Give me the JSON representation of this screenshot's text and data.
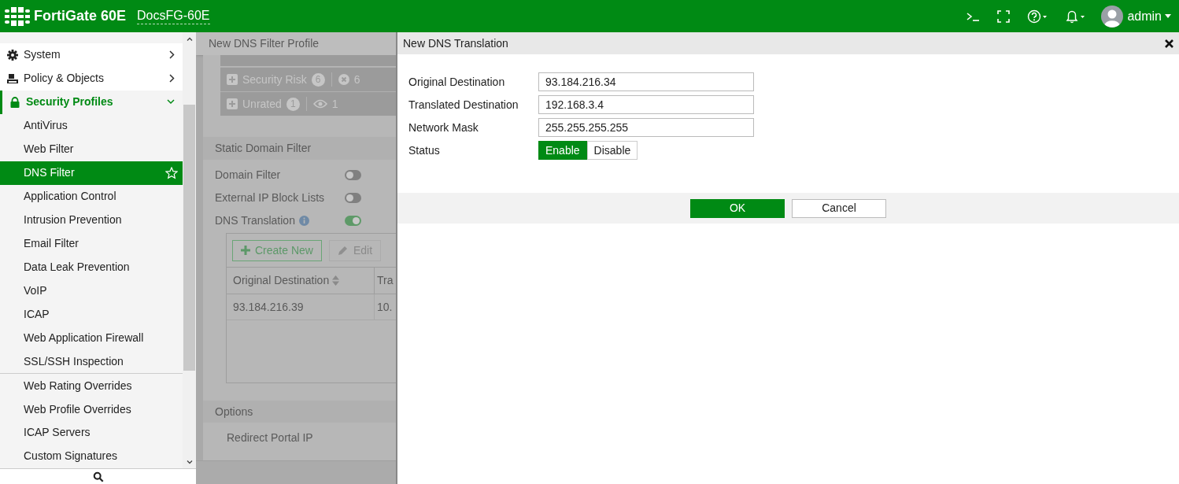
{
  "header": {
    "product": "FortiGate 60E",
    "hostname": "DocsFG-60E",
    "user": "admin"
  },
  "sidebar": {
    "items": [
      {
        "label": "System",
        "expanded": false
      },
      {
        "label": "Policy & Objects",
        "expanded": false
      },
      {
        "label": "Security Profiles",
        "expanded": true,
        "children": [
          {
            "label": "AntiVirus",
            "separator_above": false,
            "selected": false
          },
          {
            "label": "Web Filter",
            "separator_above": false,
            "selected": false
          },
          {
            "label": "DNS Filter",
            "separator_above": false,
            "selected": true
          },
          {
            "label": "Application Control",
            "separator_above": false,
            "selected": false
          },
          {
            "label": "Intrusion Prevention",
            "separator_above": false,
            "selected": false
          },
          {
            "label": "Email Filter",
            "separator_above": false,
            "selected": false
          },
          {
            "label": "Data Leak Prevention",
            "separator_above": false,
            "selected": false
          },
          {
            "label": "VoIP",
            "separator_above": false,
            "selected": false
          },
          {
            "label": "ICAP",
            "separator_above": false,
            "selected": false
          },
          {
            "label": "Web Application Firewall",
            "separator_above": false,
            "selected": false
          },
          {
            "label": "SSL/SSH Inspection",
            "separator_above": false,
            "selected": false
          },
          {
            "label": "Web Rating Overrides",
            "separator_above": true,
            "selected": false
          },
          {
            "label": "Web Profile Overrides",
            "separator_above": false,
            "selected": false
          },
          {
            "label": "ICAP Servers",
            "separator_above": false,
            "selected": false
          },
          {
            "label": "Custom Signatures",
            "separator_above": false,
            "selected": false
          }
        ]
      }
    ]
  },
  "background_page": {
    "title": "New DNS Filter Profile",
    "categories": [
      {
        "label": "Security Risk",
        "count": "6",
        "action_count": "6"
      },
      {
        "label": "Unrated",
        "count": "1",
        "action_count": "1"
      }
    ],
    "section": "Static Domain Filter",
    "toggles": [
      {
        "label": "Domain Filter",
        "on": false,
        "info": false
      },
      {
        "label": "External IP Block Lists",
        "on": false,
        "info": false
      },
      {
        "label": "DNS Translation",
        "on": true,
        "info": true
      }
    ],
    "toolbar": [
      "Create New",
      "Edit"
    ],
    "table": {
      "columns": [
        "Original Destination",
        "Tra"
      ],
      "rows": [
        [
          "93.184.216.39",
          "10."
        ]
      ]
    },
    "options_section": "Options",
    "options": [
      "Redirect Portal IP"
    ]
  },
  "dialog": {
    "title": "New DNS Translation",
    "fields": [
      {
        "label": "Original Destination",
        "value": "93.184.216.34"
      },
      {
        "label": "Translated Destination",
        "value": "192.168.3.4"
      },
      {
        "label": "Network Mask",
        "value": "255.255.255.255"
      }
    ],
    "status": {
      "label": "Status",
      "options": [
        {
          "label": "Enable",
          "selected": true
        },
        {
          "label": "Disable",
          "selected": false
        }
      ]
    },
    "buttons": [
      {
        "label": "OK",
        "kind": "primary"
      },
      {
        "label": "Cancel",
        "kind": "secondary"
      }
    ]
  }
}
